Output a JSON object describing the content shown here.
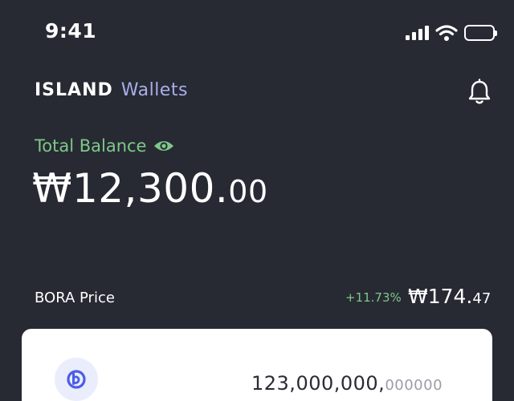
{
  "status_bar": {
    "time": "9:41",
    "icons": [
      "signal-icon",
      "wifi-icon",
      "battery-icon"
    ]
  },
  "header": {
    "brand_primary": "ISLAND",
    "brand_secondary": "Wallets",
    "notification_icon": "bell-icon"
  },
  "balance": {
    "label": "Total Balance",
    "visibility_icon": "eye-icon",
    "amount_main": "₩12,300.",
    "amount_decimal": "00"
  },
  "price": {
    "label": "BORA Price",
    "change": "+11.73%",
    "value_main": "₩174.",
    "value_decimal": "47"
  },
  "token_card": {
    "logo_icon": "bora-logo-icon",
    "amount_main": "123,000,000,",
    "amount_decimal": "000000"
  },
  "colors": {
    "background": "#272a33",
    "accent_green": "#7ec88a",
    "accent_lavender": "#a9aee8",
    "logo_blue": "#4d5ce8"
  }
}
